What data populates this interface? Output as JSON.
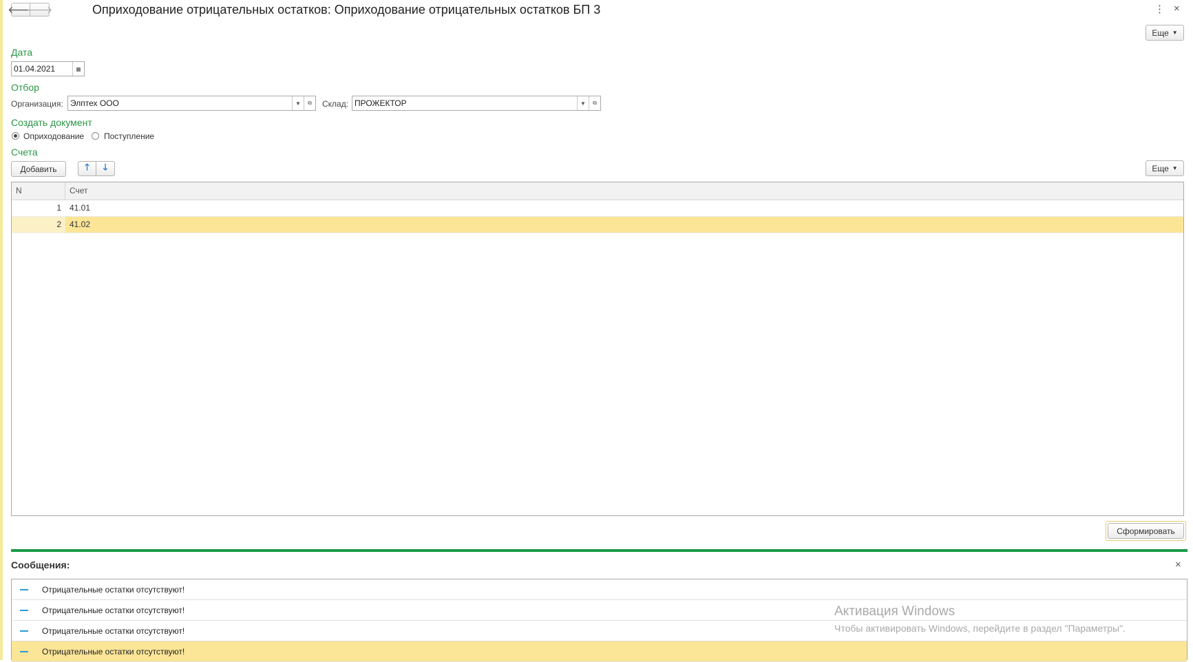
{
  "window": {
    "title": "Оприходование отрицательных остатков: Оприходование отрицательных остатков БП 3",
    "back_icon": "arrow-left-icon",
    "forward_icon": "arrow-right-icon",
    "menu_icon": "⋮",
    "close_icon": "×",
    "more_label": "Еще"
  },
  "date_group": {
    "title": "Дата",
    "value": "01.04.2021"
  },
  "filter_group": {
    "title": "Отбор",
    "org_label": "Организация:",
    "org_value": "Элптех ООО",
    "warehouse_label": "Склад:",
    "warehouse_value": "ПРОЖЕКТОР"
  },
  "create_doc_group": {
    "title": "Создать документ",
    "options": [
      {
        "label": "Оприходование",
        "selected": true
      },
      {
        "label": "Поступление",
        "selected": false
      }
    ]
  },
  "accounts": {
    "title": "Счета",
    "add_label": "Добавить",
    "more_label": "Еще",
    "columns": [
      "N",
      "Счет"
    ],
    "rows": [
      {
        "n": "1",
        "account": "41.01",
        "selected": false
      },
      {
        "n": "2",
        "account": "41.02",
        "selected": true
      }
    ]
  },
  "generate_label": "Сформировать",
  "messages": {
    "title": "Сообщения:",
    "close_icon": "×",
    "items": [
      {
        "text": "Отрицательные остатки отсутствуют!",
        "selected": false
      },
      {
        "text": "Отрицательные остатки отсутствуют!",
        "selected": false
      },
      {
        "text": "Отрицательные остатки отсутствуют!",
        "selected": false
      },
      {
        "text": "Отрицательные остатки отсутствуют!",
        "selected": true
      }
    ]
  },
  "watermark": {
    "line1": "Активация Windows",
    "line2": "Чтобы активировать Windows, перейдите в раздел \"Параметры\"."
  },
  "colors": {
    "group_title": "#2a9645",
    "selection": "#fbe597",
    "separator": "#1a9a48",
    "message_dash": "#2a9ad8"
  }
}
